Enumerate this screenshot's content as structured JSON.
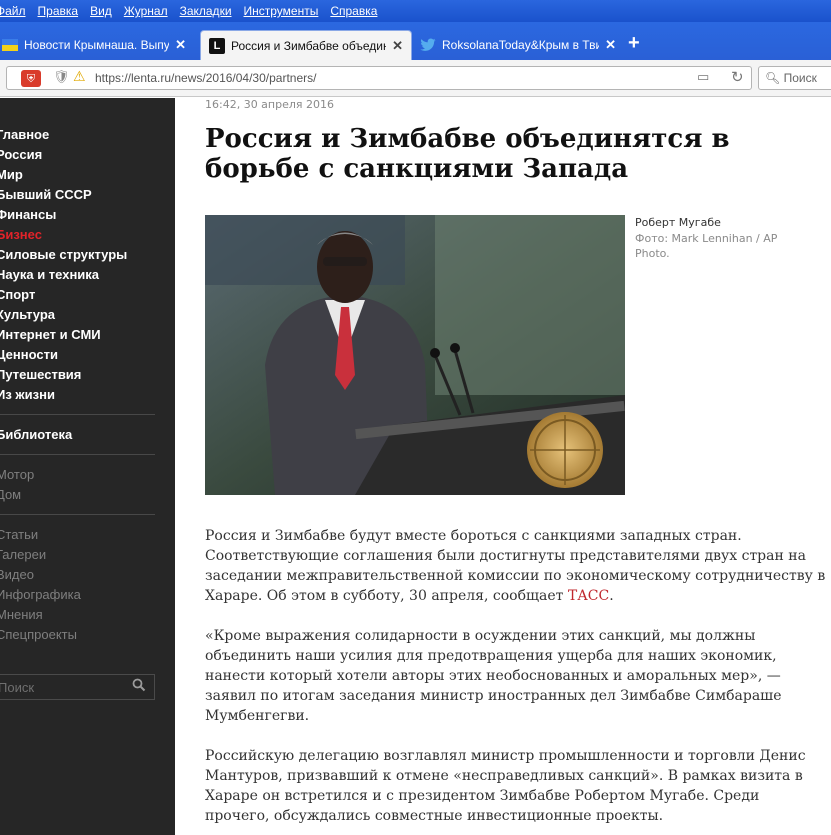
{
  "menubar": {
    "items": [
      "Файл",
      "Правка",
      "Вид",
      "Журнал",
      "Закладки",
      "Инструменты",
      "Справка"
    ]
  },
  "tabs": [
    {
      "label": "Новости Крымнаша. Выпуск...",
      "close": "✕"
    },
    {
      "label": "Россия и Зимбабве объедин...",
      "close": "✕"
    },
    {
      "label": "RoksolanaToday&Крым в Тви...",
      "close": "✕"
    }
  ],
  "new_tab": "+",
  "navbar": {
    "url": "https://lenta.ru/news/2016/04/30/partners/",
    "search_placeholder": "Поиск"
  },
  "sidebar": {
    "sections": [
      "Главное",
      "Россия",
      "Мир",
      "Бывший СССР",
      "Финансы",
      "Бизнес",
      "Силовые структуры",
      "Наука и техника",
      "Спорт",
      "Культура",
      "Интернет и СМИ",
      "Ценности",
      "Путешествия",
      "Из жизни"
    ],
    "current": "Бизнес",
    "library": "Библиотека",
    "partners": [
      "Мотор",
      "Дом"
    ],
    "extra": [
      "Статьи",
      "Галереи",
      "Видео",
      "Инфографика",
      "Мнения",
      "Спецпроекты"
    ],
    "search_placeholder": "Поиск"
  },
  "article": {
    "timestamp": "16:42, 30 апреля 2016",
    "title": "Россия и Зимбабве объединятся в борьбе с санкциями Запада",
    "photo_caption": "Роберт Мугабе",
    "photo_credit": "Фото: Mark Lennihan / AP Photo.",
    "p1_text": "Россия и Зимбабве будут вместе бороться с санкциями западных стран. Соответствующие соглашения были достигнуты представителями двух стран на заседании межправительственной комиссии по экономическому сотрудничеству в Хараре. Об этом в субботу, 30 апреля, сообщает ",
    "p1_link": "ТАСС",
    "p1_end": ".",
    "p2": "«Кроме выражения солидарности в осуждении этих санкций, мы должны объединить наши усилия для предотвращения ущерба для наших экономик, нанести который хотели авторы этих необоснованных и аморальных мер», — заявил по итогам заседания министр иностранных дел Зимбабве Симбараше Мумбенгегви.",
    "p3": "Российскую делегацию возглавлял министр промышленности и торговли Денис Мантуров, призвавший к отмене «несправедливых санкций». В рамках визита в Хараре он встретился и с президентом Зимбабве Робертом Мугабе. Среди прочего, обсуждались совместные инвестиционные проекты."
  }
}
